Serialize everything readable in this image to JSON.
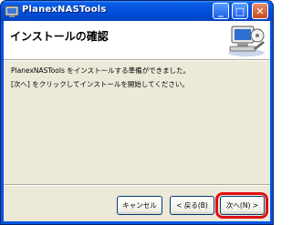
{
  "window": {
    "title": "PlanexNASTools",
    "buttons": {
      "minimize": "_",
      "maximize": "□",
      "close": "✕"
    }
  },
  "header": {
    "title": "インストールの確認",
    "graphic_icon": "computer-setup-icon"
  },
  "body": {
    "line1": "PlanexNASTools をインストールする準備ができました。",
    "line2": "[次へ] をクリックしてインストールを開始してください。"
  },
  "footer": {
    "cancel_label": "キャンセル",
    "back_label": "< 戻る(B)",
    "next_label": "次へ(N) >"
  },
  "colors": {
    "titlebar": "#0054e3",
    "dialog_bg": "#ece9d8",
    "highlight": "#e01010"
  }
}
